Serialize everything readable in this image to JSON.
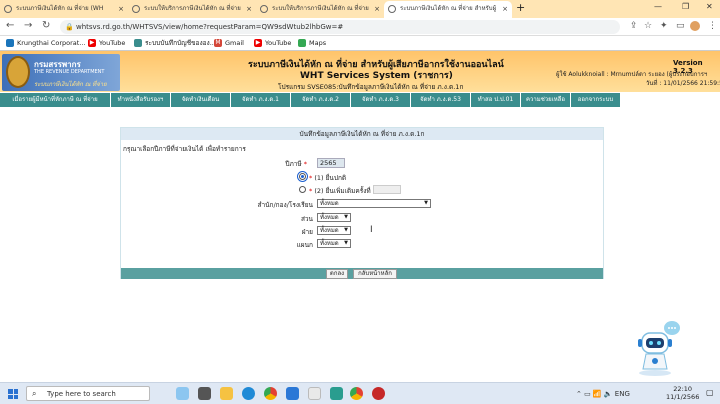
{
  "browser": {
    "tabs": [
      {
        "label": "ระบบภาษีเงินได้หัก ณ ที่จ่าย (WH",
        "active": false
      },
      {
        "label": "ระบบให้บริการภาษีเงินได้หัก ณ ที่จ่าย",
        "active": false
      },
      {
        "label": "ระบบให้บริการภาษีเงินได้หัก ณ ที่จ่าย",
        "active": false
      },
      {
        "label": "ระบบภาษีเงินได้หัก ณ ที่จ่าย สำหรับผู้",
        "active": true
      }
    ],
    "new_tab": "+",
    "url": "whtsvs.rd.go.th/WHTSVS/view/home?requestParam=QW9sdWtub2lhbGw=#",
    "bookmarks": [
      "Krungthai Corporat...",
      "YouTube",
      "ระบบบันทึกบัญชีขององ...",
      "Gmail",
      "YouTube",
      "Maps"
    ]
  },
  "header": {
    "logo_org": "กรมสรรพากร",
    "logo_org_en": "THE REVENUE DEPARTMENT",
    "logo_sub": "ระบบภาษีเงินได้หัก ณ ที่จ่าย",
    "system_title_th": "ระบบภาษีเงินได้หัก ณ ที่จ่าย สำหรับผู้เสียภาษีอากรใช้งานออนไลน์",
    "system_title_en": "WHT Services System  (ราชการ)",
    "program": "โปรแกรม SVSE085:บันทึกข้อมูลภาษีเงินได้หัก ณ ที่จ่าย ภ.ง.ด.1ก",
    "version": "Version 3.2.3",
    "user": "ผู้ใช้  Aolukknoiall : Mrnumปล์ดา ระยอง   (ผู้ประกอบการฯ",
    "date": "วันที่ : 11/01/2566 21:59:5"
  },
  "menu": [
    "เมื่อรายผู้มีหน้าที่หักภาษี ณ ที่จ่าย",
    "ทำหนังสือรับรองฯ",
    "จัดทำเงินเดือน",
    "จัดทำ ภ.ง.ด.1",
    "จัดทำ ภ.ง.ด.2",
    "จัดทำ ภ.ง.ด.3",
    "จัดทำ ภ.ง.ด.53",
    "ทำสอ ป.ป.01",
    "ความช่วยเหลือ",
    "ออกจากระบบ"
  ],
  "form": {
    "heading": "บันทึกข้อมูลภาษีเงินได้หัก ณ ที่จ่าย ภ.ง.ด.1ก",
    "intro": "กรุณาเลือกปีภาษีที่จ่ายเงินได้ เพื่อทำรายการ",
    "year_label": "ปีภาษี",
    "year_value": "2565",
    "radio1": "(1) ยื่นปกติ",
    "radio2": "(2) ยื่นเพิ่มเติมครั้งที่",
    "office_label": "สำนัก/กอง/โรงเรียน",
    "office_value": "ทั้งหมด",
    "section_label": "ส่วน",
    "section_value": "ทั้งหมด",
    "division_label": "ฝ่าย",
    "division_value": "ทั้งหมด",
    "unit_label": "แผนก",
    "unit_value": "ทั้งหมด",
    "required_mark": "*",
    "ok_button": "ตกลง",
    "back_button": "กลับหน้าหลัก"
  },
  "taskbar": {
    "search_placeholder": "Type here to search",
    "time": "22:10",
    "date": "11/1/2566"
  },
  "colors": {
    "menu": "#3a8d8d",
    "banner": "#ffc46a",
    "form_footer": "#5aa0a0"
  }
}
